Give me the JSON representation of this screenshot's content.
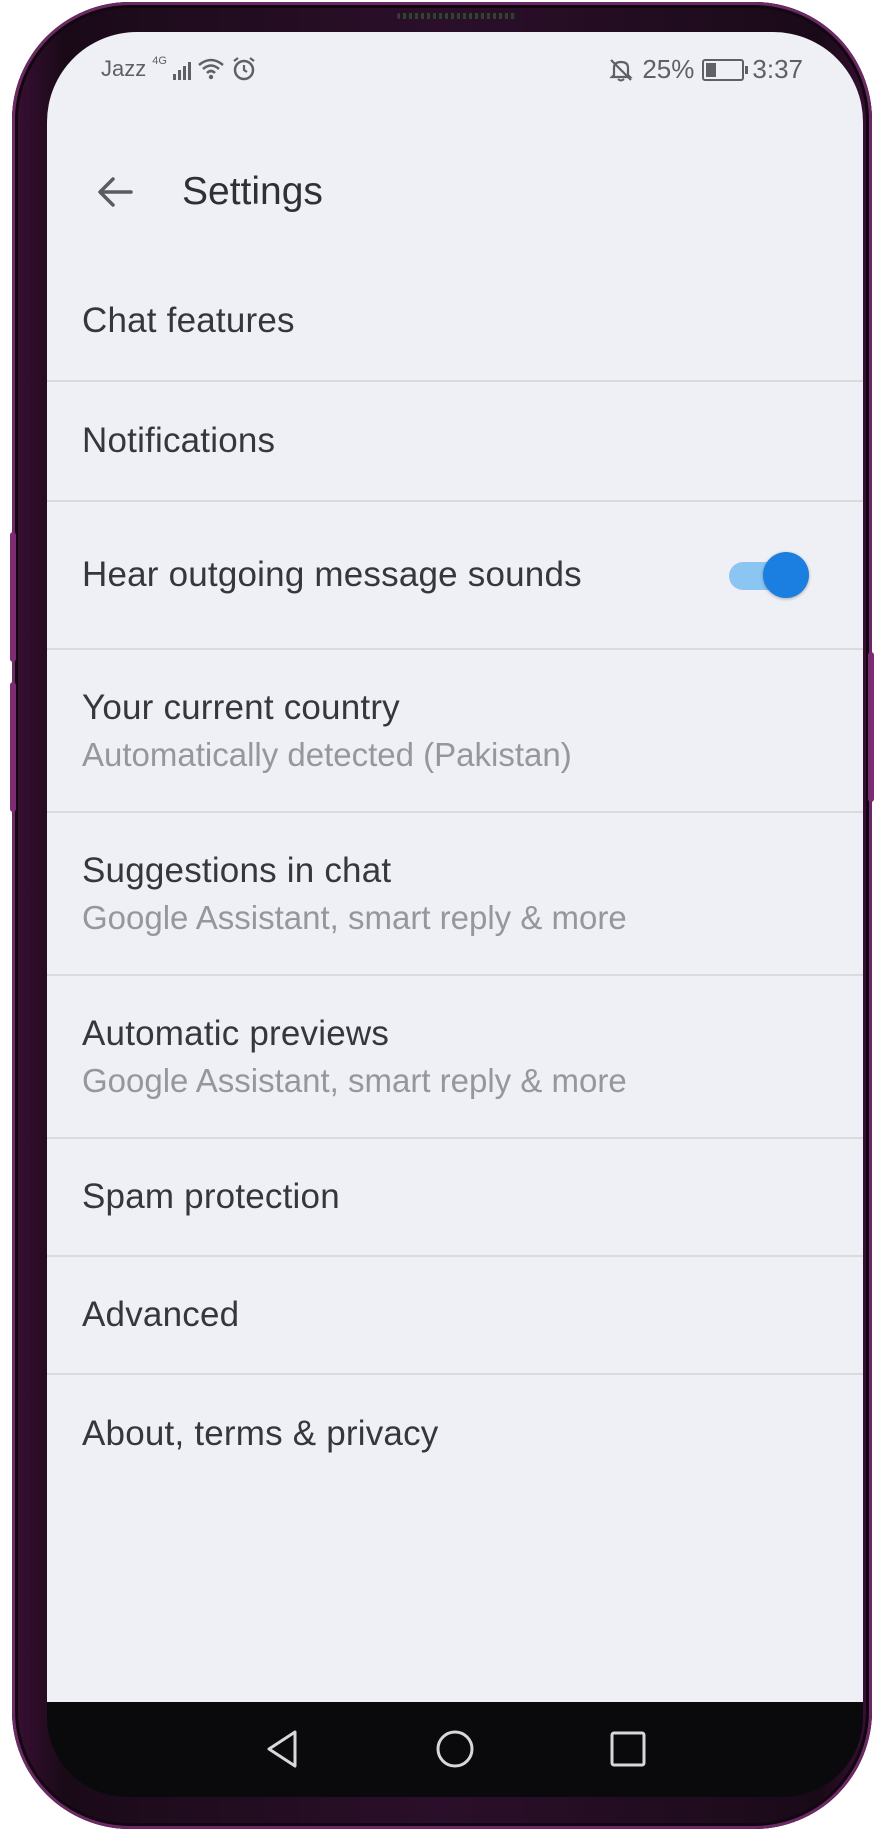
{
  "status_bar": {
    "carrier": "Jazz",
    "network": "4G",
    "battery_percent": "25%",
    "time": "3:37",
    "icons": [
      "signal-icon",
      "wifi-icon",
      "alarm-icon",
      "bell-off-icon",
      "battery-icon"
    ]
  },
  "app_bar": {
    "title": "Settings",
    "back_icon": "arrow-back-icon"
  },
  "settings": {
    "items": [
      {
        "title": "Chat features"
      },
      {
        "title": "Notifications"
      },
      {
        "title": "Hear outgoing message sounds",
        "toggle_on": true
      },
      {
        "title": "Your current country",
        "subtitle": "Automatically detected (Pakistan)"
      },
      {
        "title": "Suggestions in chat",
        "subtitle": "Google Assistant, smart reply & more"
      },
      {
        "title": "Automatic previews",
        "subtitle": "Google Assistant, smart reply & more"
      },
      {
        "title": "Spam protection"
      },
      {
        "title": "Advanced"
      },
      {
        "title": "About, terms & privacy"
      }
    ]
  },
  "nav_bar": {
    "buttons": [
      "nav-back-icon",
      "nav-home-icon",
      "nav-recents-icon"
    ]
  },
  "colors": {
    "background": "#eff0f5",
    "accent": "#1a7fe0",
    "toggle_track": "#8bc6f2",
    "frame": "#2b0f2a"
  }
}
